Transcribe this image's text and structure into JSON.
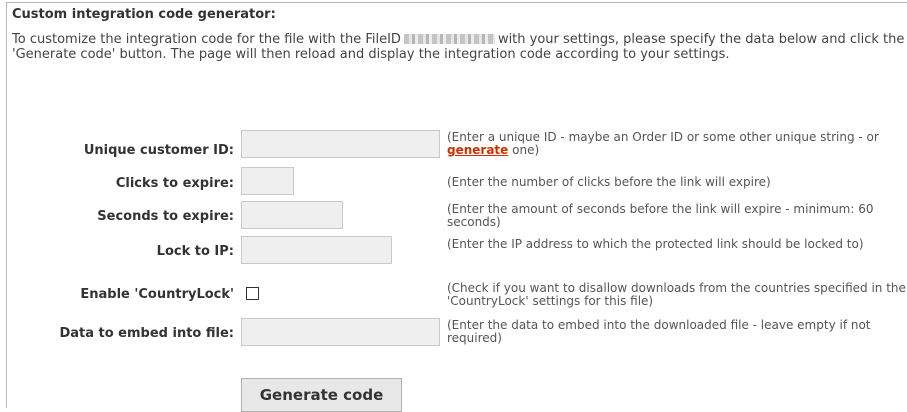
{
  "header": {
    "title": "Custom integration code generator:"
  },
  "intro": {
    "text_before": "To customize the integration code for the file with the FileID",
    "text_after": "with your settings, please specify the data below and click the 'Generate code' button. The page will then reload and display the integration code according to your settings."
  },
  "form": {
    "customer_id": {
      "label": "Unique customer ID:",
      "value": "",
      "hint_before": "(Enter a unique ID - maybe an Order ID or some other unique string - or ",
      "hint_link": "generate",
      "hint_after": " one)"
    },
    "clicks": {
      "label": "Clicks to expire:",
      "value": "",
      "hint": "(Enter the number of clicks before the link will expire)"
    },
    "seconds": {
      "label": "Seconds to expire:",
      "value": "",
      "hint": "(Enter the amount of seconds before the link will expire - minimum: 60 seconds)"
    },
    "lock_ip": {
      "label": "Lock to IP:",
      "value": "",
      "hint": "(Enter the IP address to which the protected link should be locked to)"
    },
    "country_lock": {
      "label": "Enable 'CountryLock'",
      "checked": false,
      "hint": "(Check if you want to disallow downloads from the countries specified in the 'CountryLock' settings for this file)"
    },
    "embed_data": {
      "label": "Data to embed into file:",
      "value": "",
      "hint": "(Enter the data to embed into the downloaded file - leave empty if not required)"
    }
  },
  "actions": {
    "generate_label": "Generate code"
  },
  "colors": {
    "link": "#d03000",
    "input_bg": "#efefef",
    "button_bg": "#e8e8e8"
  }
}
